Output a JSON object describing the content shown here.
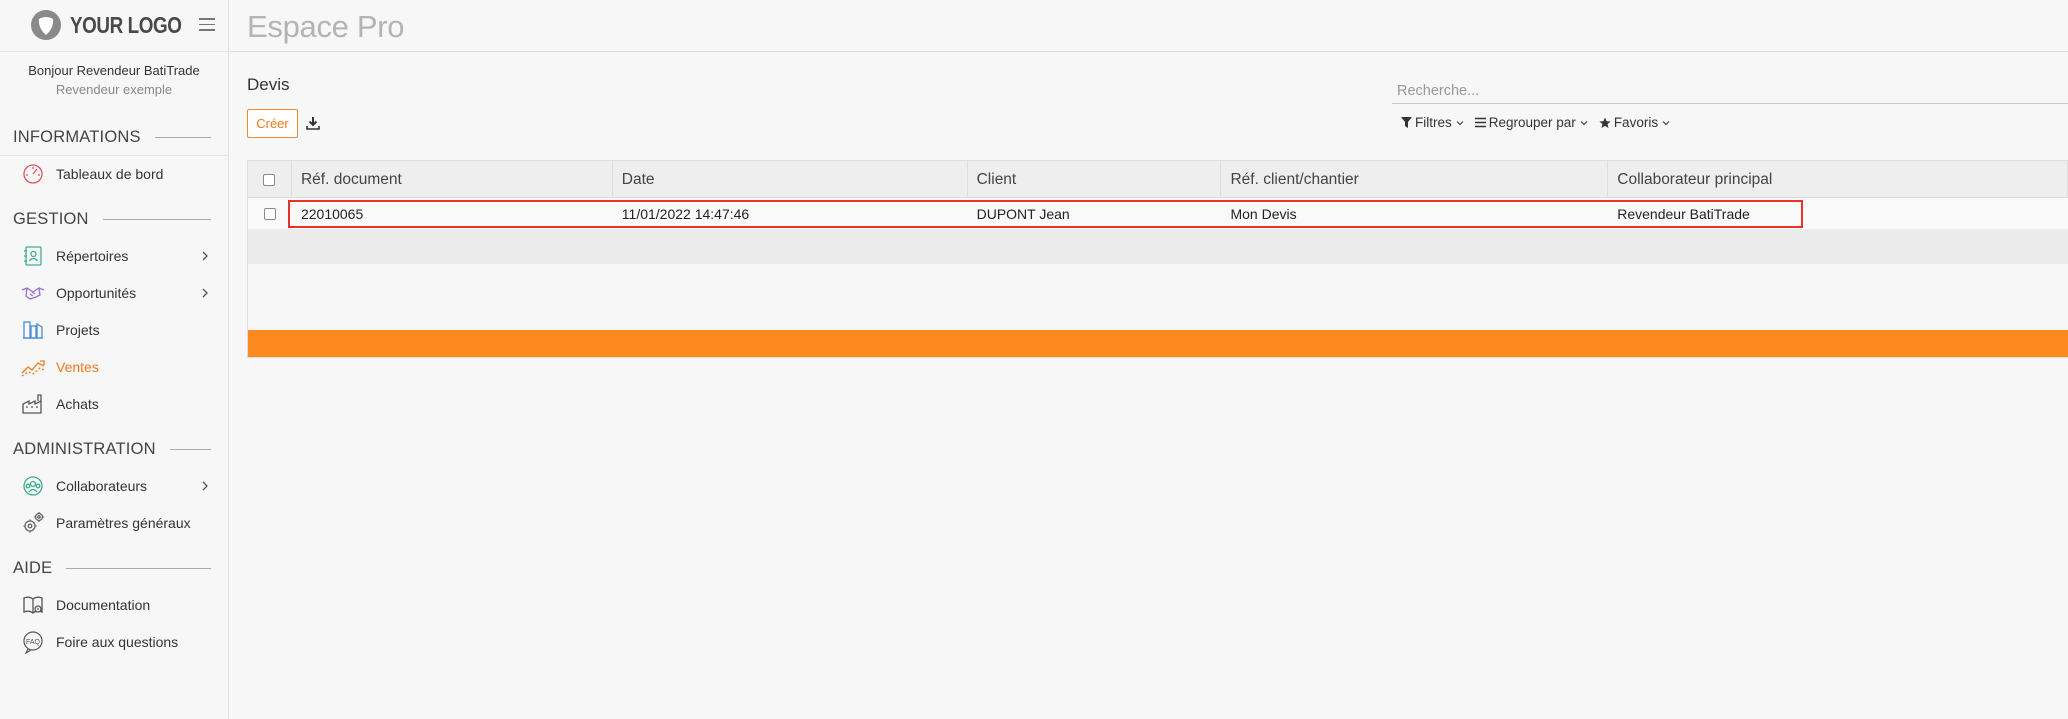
{
  "logo": {
    "text": "YOUR LOGO"
  },
  "user": {
    "greeting": "Bonjour Revendeur BatiTrade",
    "role": "Revendeur exemple"
  },
  "sidebar": {
    "sections": [
      {
        "title": "INFORMATIONS"
      },
      {
        "title": "GESTION"
      },
      {
        "title": "ADMINISTRATION"
      },
      {
        "title": "AIDE"
      }
    ],
    "items": [
      {
        "label": "Tableaux de bord",
        "icon": "dashboard-icon"
      },
      {
        "label": "Répertoires",
        "icon": "contacts-icon"
      },
      {
        "label": "Opportunités",
        "icon": "handshake-icon"
      },
      {
        "label": "Projets",
        "icon": "projects-icon"
      },
      {
        "label": "Ventes",
        "icon": "sales-chart-icon",
        "active": true
      },
      {
        "label": "Achats",
        "icon": "factory-icon"
      },
      {
        "label": "Collaborateurs",
        "icon": "team-icon"
      },
      {
        "label": "Paramètres généraux",
        "icon": "gears-icon"
      },
      {
        "label": "Documentation",
        "icon": "book-icon"
      },
      {
        "label": "Foire aux questions",
        "icon": "faq-icon"
      }
    ]
  },
  "header": {
    "title": "Espace Pro"
  },
  "breadcrumb": "Devis",
  "toolbar": {
    "create_label": "Créer"
  },
  "search": {
    "placeholder": "Recherche..."
  },
  "filters": {
    "filters_label": "Filtres",
    "group_label": "Regrouper par",
    "favorites_label": "Favoris"
  },
  "table": {
    "columns": [
      "Réf. document",
      "Date",
      "Client",
      "Réf. client/chantier",
      "Collaborateur principal"
    ],
    "rows": [
      [
        "22010065",
        "11/01/2022 14:47:46",
        "DUPONT Jean",
        "Mon Devis",
        "Revendeur BatiTrade"
      ]
    ]
  },
  "colors": {
    "accent": "#f0781e",
    "orange_bar": "#fd8a1e",
    "highlight": "#e4342a"
  }
}
